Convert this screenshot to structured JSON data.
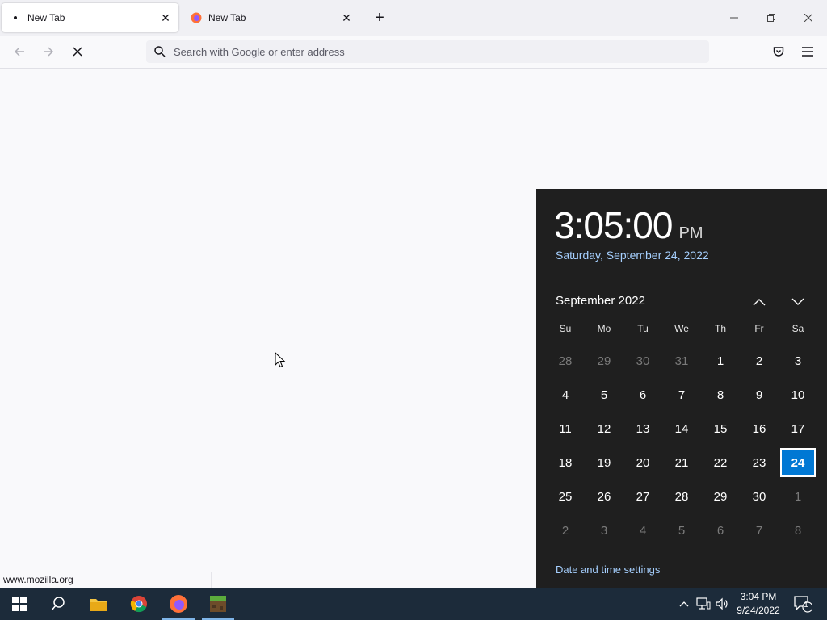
{
  "browser": {
    "tabs": [
      {
        "title": "New Tab",
        "active": true
      },
      {
        "title": "New Tab",
        "active": false
      }
    ],
    "url_placeholder": "Search with Google or enter address",
    "status_text": "www.mozilla.org"
  },
  "clock_flyout": {
    "time": "3:05:00",
    "ampm": "PM",
    "long_date": "Saturday, September 24, 2022",
    "month_label": "September 2022",
    "weekdays": [
      "Su",
      "Mo",
      "Tu",
      "We",
      "Th",
      "Fr",
      "Sa"
    ],
    "weeks": [
      [
        "28",
        "29",
        "30",
        "31",
        "1",
        "2",
        "3"
      ],
      [
        "4",
        "5",
        "6",
        "7",
        "8",
        "9",
        "10"
      ],
      [
        "11",
        "12",
        "13",
        "14",
        "15",
        "16",
        "17"
      ],
      [
        "18",
        "19",
        "20",
        "21",
        "22",
        "23",
        "24"
      ],
      [
        "25",
        "26",
        "27",
        "28",
        "29",
        "30",
        "1"
      ],
      [
        "2",
        "3",
        "4",
        "5",
        "6",
        "7",
        "8"
      ]
    ],
    "selected_day": "24",
    "settings_link": "Date and time settings"
  },
  "taskbar": {
    "time": "3:04 PM",
    "date": "9/24/2022",
    "notification_count": "1"
  },
  "colors": {
    "accent": "#0078d4",
    "flyout_bg": "#1f1f1f",
    "taskbar_bg": "#1c2b3a",
    "link": "#a6d0ff"
  }
}
